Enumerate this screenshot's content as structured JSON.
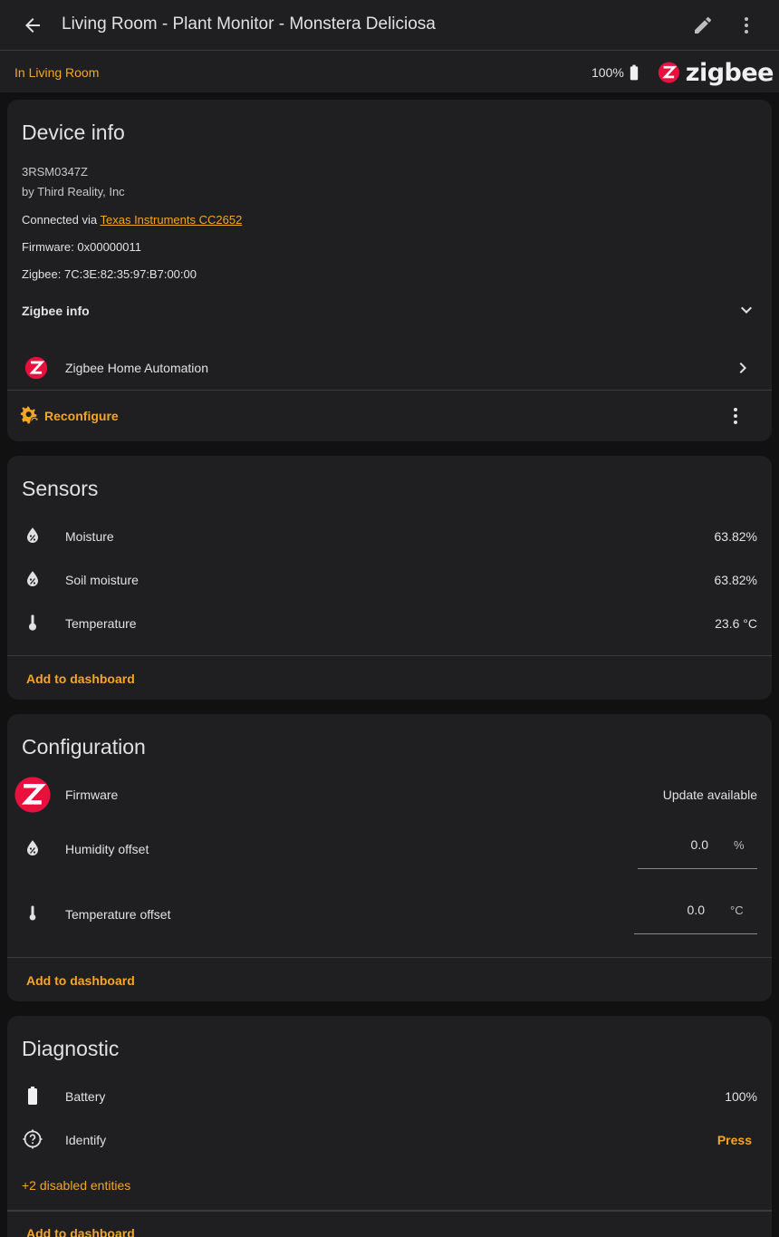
{
  "header": {
    "title": "Living Room - Plant Monitor - Monstera Deliciosa",
    "area_link": "In Living Room",
    "battery": "100%",
    "logo_word": "zigbee"
  },
  "device_info": {
    "title": "Device info",
    "model": "3RSM0347Z",
    "manufacturer": "by Third Reality, Inc",
    "connected_via_label": "Connected via ",
    "connected_via_link": "Texas Instruments CC2652",
    "firmware": "Firmware: 0x00000011",
    "zigbee": "Zigbee: 7C:3E:82:35:97:B7:00:00",
    "zigbee_info_label": "Zigbee info",
    "integration": "Zigbee Home Automation",
    "reconfigure": "Reconfigure"
  },
  "sensors": {
    "title": "Sensors",
    "items": [
      {
        "name": "Moisture",
        "value": "63.82%",
        "icon": "water-percent-icon"
      },
      {
        "name": "Soil moisture",
        "value": "63.82%",
        "icon": "water-percent-icon"
      },
      {
        "name": "Temperature",
        "value": "23.6 °C",
        "icon": "thermometer-icon"
      }
    ],
    "add_to_dashboard": "Add to dashboard"
  },
  "configuration": {
    "title": "Configuration",
    "firmware_label": "Firmware",
    "firmware_value": "Update available",
    "humidity_label": "Humidity offset",
    "humidity_value": "0.0",
    "humidity_unit": "%",
    "temperature_label": "Temperature offset",
    "temperature_value": "0.0",
    "temperature_unit": "°C",
    "add_to_dashboard": "Add to dashboard"
  },
  "diagnostic": {
    "title": "Diagnostic",
    "battery_label": "Battery",
    "battery_value": "100%",
    "identify_label": "Identify",
    "identify_action": "Press",
    "disabled_entities": "+2 disabled entities",
    "add_to_dashboard": "Add to dashboard"
  },
  "colors": {
    "accent": "#f5a623",
    "zigbee_red": "#e8113e",
    "card_bg": "#1f1f21",
    "page_bg": "#111111"
  }
}
